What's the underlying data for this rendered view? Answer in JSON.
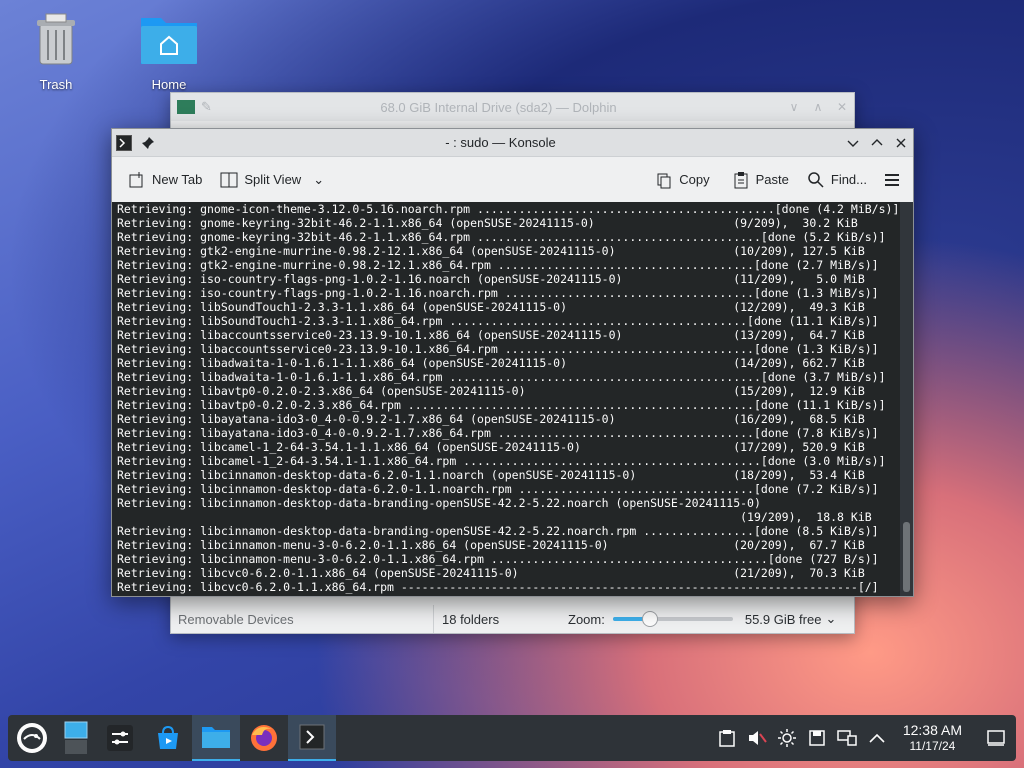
{
  "desktop": {
    "icons": [
      {
        "label": "Trash"
      },
      {
        "label": "Home"
      }
    ]
  },
  "dolphin": {
    "title": "68.0 GiB Internal Drive (sda2) — Dolphin",
    "places_label": "Removable Devices",
    "folders": "18 folders",
    "zoom_label": "Zoom:",
    "zoom_level": 0.3,
    "free": "55.9 GiB free"
  },
  "konsole": {
    "title": "- : sudo — Konsole",
    "toolbar": {
      "new_tab": "New Tab",
      "split_view": "Split View",
      "copy": "Copy",
      "paste": "Paste",
      "find": "Find..."
    },
    "lines": [
      "Retrieving: gnome-icon-theme-3.12.0-5.16.noarch.rpm ...........................................[done (4.2 MiB/s)]",
      "Retrieving: gnome-keyring-32bit-46.2-1.1.x86_64 (openSUSE-20241115-0)                    (9/209),  30.2 KiB",
      "Retrieving: gnome-keyring-32bit-46.2-1.1.x86_64.rpm .........................................[done (5.2 KiB/s)]",
      "Retrieving: gtk2-engine-murrine-0.98.2-12.1.x86_64 (openSUSE-20241115-0)                 (10/209), 127.5 KiB",
      "Retrieving: gtk2-engine-murrine-0.98.2-12.1.x86_64.rpm .....................................[done (2.7 MiB/s)]",
      "Retrieving: iso-country-flags-png-1.0.2-1.16.noarch (openSUSE-20241115-0)                (11/209),   5.0 MiB",
      "Retrieving: iso-country-flags-png-1.0.2-1.16.noarch.rpm ....................................[done (1.3 MiB/s)]",
      "Retrieving: libSoundTouch1-2.3.3-1.1.x86_64 (openSUSE-20241115-0)                        (12/209),  49.3 KiB",
      "Retrieving: libSoundTouch1-2.3.3-1.1.x86_64.rpm ...........................................[done (11.1 KiB/s)]",
      "Retrieving: libaccountsservice0-23.13.9-10.1.x86_64 (openSUSE-20241115-0)                (13/209),  64.7 KiB",
      "Retrieving: libaccountsservice0-23.13.9-10.1.x86_64.rpm ....................................[done (1.3 KiB/s)]",
      "Retrieving: libadwaita-1-0-1.6.1-1.1.x86_64 (openSUSE-20241115-0)                        (14/209), 662.7 KiB",
      "Retrieving: libadwaita-1-0-1.6.1-1.1.x86_64.rpm .............................................[done (3.7 MiB/s)]",
      "Retrieving: libavtp0-0.2.0-2.3.x86_64 (openSUSE-20241115-0)                              (15/209),  12.9 KiB",
      "Retrieving: libavtp0-0.2.0-2.3.x86_64.rpm ..................................................[done (11.1 KiB/s)]",
      "Retrieving: libayatana-ido3-0_4-0-0.9.2-1.7.x86_64 (openSUSE-20241115-0)                 (16/209),  68.5 KiB",
      "Retrieving: libayatana-ido3-0_4-0-0.9.2-1.7.x86_64.rpm .....................................[done (7.8 KiB/s)]",
      "Retrieving: libcamel-1_2-64-3.54.1-1.1.x86_64 (openSUSE-20241115-0)                      (17/209), 520.9 KiB",
      "Retrieving: libcamel-1_2-64-3.54.1-1.1.x86_64.rpm ...........................................[done (3.0 MiB/s)]",
      "Retrieving: libcinnamon-desktop-data-6.2.0-1.1.noarch (openSUSE-20241115-0)              (18/209),  53.4 KiB",
      "Retrieving: libcinnamon-desktop-data-6.2.0-1.1.noarch.rpm ..................................[done (7.2 KiB/s)]",
      "Retrieving: libcinnamon-desktop-data-branding-openSUSE-42.2-5.22.noarch (openSUSE-20241115-0)",
      "                                                                                          (19/209),  18.8 KiB",
      "Retrieving: libcinnamon-desktop-data-branding-openSUSE-42.2-5.22.noarch.rpm ................[done (8.5 KiB/s)]",
      "Retrieving: libcinnamon-menu-3-0-6.2.0-1.1.x86_64 (openSUSE-20241115-0)                  (20/209),  67.7 KiB",
      "Retrieving: libcinnamon-menu-3-0-6.2.0-1.1.x86_64.rpm ........................................[done (727 B/s)]",
      "Retrieving: libcvc0-6.2.0-1.1.x86_64 (openSUSE-20241115-0)                               (21/209),  70.3 KiB",
      "Retrieving: libcvc0-6.2.0-1.1.x86_64.rpm ------------------------------------------------------------------[/]"
    ]
  },
  "taskbar": {
    "time": "12:38 AM",
    "date": "11/17/24"
  }
}
